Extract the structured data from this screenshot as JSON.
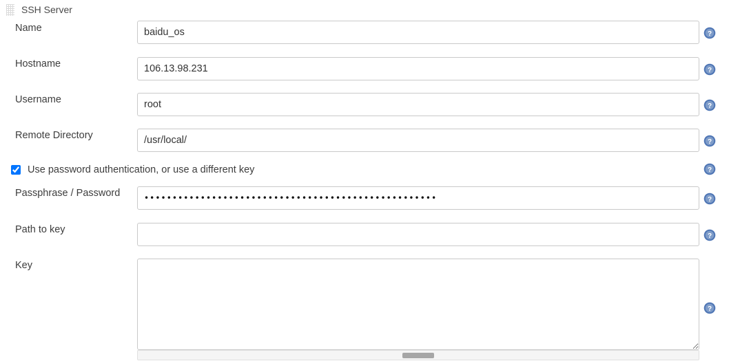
{
  "panel": {
    "title": "SSH Server",
    "drag_handle_icon": "drag-grip-icon"
  },
  "help_icon": {
    "name": "help-question-icon",
    "glyph": "?",
    "circle_color": "#4f76b5",
    "inner_color": "#88a4cf",
    "mark_color": "#ffffff"
  },
  "fields": {
    "name": {
      "label": "Name",
      "value": "baidu_os",
      "placeholder": ""
    },
    "hostname": {
      "label": "Hostname",
      "value": "106.13.98.231",
      "placeholder": ""
    },
    "username": {
      "label": "Username",
      "value": "root",
      "placeholder": ""
    },
    "remote_directory": {
      "label": "Remote Directory",
      "value": "/usr/local/",
      "placeholder": ""
    },
    "passphrase": {
      "label": "Passphrase / Password",
      "masked_value": "••••••••••••••••••••••••••••••••••••••••••••••••••••",
      "placeholder": ""
    },
    "path_to_key": {
      "label": "Path to key",
      "value": "",
      "placeholder": ""
    },
    "key": {
      "label": "Key",
      "value": "",
      "placeholder": ""
    }
  },
  "checkbox": {
    "label": "Use password authentication, or use a different key",
    "checked": true
  },
  "scrollbar": {
    "orientation": "horizontal",
    "thumb_position": "center"
  }
}
